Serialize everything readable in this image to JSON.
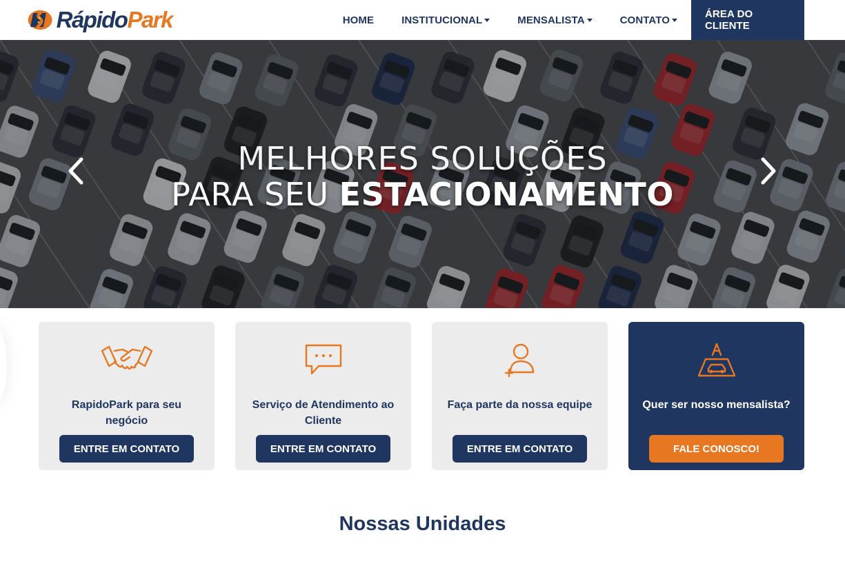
{
  "brand": {
    "name_part1": "Rápido",
    "name_part2": "Park",
    "navy": "#1f3661",
    "orange": "#e87722"
  },
  "nav": {
    "items": [
      {
        "label": "HOME",
        "dropdown": false
      },
      {
        "label": "INSTITUCIONAL",
        "dropdown": true
      },
      {
        "label": "MENSALISTA",
        "dropdown": true
      },
      {
        "label": "CONTATO",
        "dropdown": true
      }
    ],
    "cta_label": "ÁREA DO CLIENTE"
  },
  "hero": {
    "line1": "MELHORES SOLUÇÕES",
    "line2_thin": "PARA SEU ",
    "line2_bold": "ESTACIONAMENTO",
    "prev_icon": "chevron-left-icon",
    "next_icon": "chevron-right-icon"
  },
  "cards": [
    {
      "icon": "handshake-icon",
      "title": "RapidoPark para seu negócio",
      "button": "ENTRE EM CONTATO"
    },
    {
      "icon": "chat-bubble-icon",
      "title": "Serviço de Atendimento ao Cliente",
      "button": "ENTRE EM CONTATO"
    },
    {
      "icon": "add-user-icon",
      "title": "Faça parte da nossa equipe",
      "button": "ENTRE EM CONTATO"
    },
    {
      "icon": "parking-car-icon",
      "title": "Quer ser nosso mensalista?",
      "button": "FALE CONOSCO!"
    }
  ],
  "section": {
    "title": "Nossas Unidades"
  }
}
